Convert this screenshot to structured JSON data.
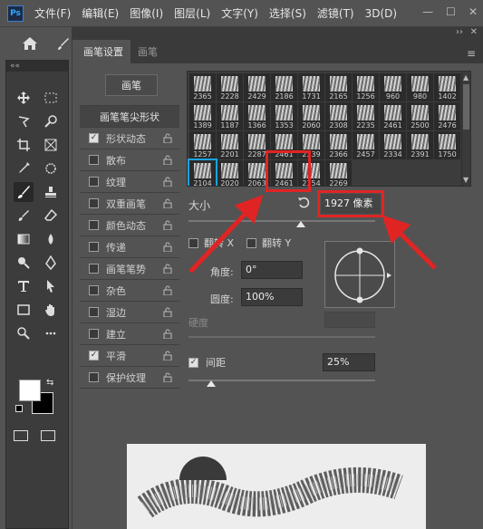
{
  "app": {
    "logo": "Ps"
  },
  "menu": [
    "文件(F)",
    "编辑(E)",
    "图像(I)",
    "图层(L)",
    "文字(Y)",
    "选择(S)",
    "滤镜(T)",
    "3D(D)"
  ],
  "window_controls": [
    "—",
    "☐",
    "✕"
  ],
  "panel": {
    "strip_glyphs": [
      "››",
      "✕"
    ],
    "tabs": [
      {
        "label": "画笔设置",
        "active": true
      },
      {
        "label": "画笔",
        "active": false
      }
    ],
    "menu_glyph": "≡",
    "brush_button": "画笔",
    "options": [
      {
        "label": "画笔笔尖形状",
        "header": true
      },
      {
        "label": "形状动态",
        "checked": true,
        "lock": true
      },
      {
        "label": "散布",
        "checked": false,
        "lock": true
      },
      {
        "label": "纹理",
        "checked": false,
        "lock": true
      },
      {
        "label": "双重画笔",
        "checked": false,
        "lock": true
      },
      {
        "label": "颜色动态",
        "checked": false,
        "lock": true
      },
      {
        "label": "传递",
        "checked": false,
        "lock": true
      },
      {
        "label": "画笔笔势",
        "checked": false,
        "lock": true
      },
      {
        "label": "杂色",
        "checked": false,
        "lock": true
      },
      {
        "label": "湿边",
        "checked": false,
        "lock": true
      },
      {
        "label": "建立",
        "checked": false,
        "lock": true
      },
      {
        "label": "平滑",
        "checked": true,
        "lock": true
      },
      {
        "label": "保护纹理",
        "checked": false,
        "lock": true
      }
    ],
    "brush_tips": [
      "2365",
      "2228",
      "2429",
      "2186",
      "1731",
      "2165",
      "1256",
      "960",
      "980",
      "1402",
      "1389",
      "1187",
      "1366",
      "1353",
      "2060",
      "2308",
      "2235",
      "2461",
      "2500",
      "2476",
      "1257",
      "2201",
      "2287",
      "2461",
      "2339",
      "2366",
      "2457",
      "2334",
      "2391",
      "1750",
      "2104",
      "2020",
      "2063",
      "2461",
      "2354",
      "2269"
    ],
    "selected_tip": "2104",
    "size_label": "大小",
    "size_value": "1927 像素",
    "size_slider": 0.6,
    "flip_x": "翻转 X",
    "flip_y": "翻转 Y",
    "angle_label": "角度:",
    "angle_value": "0°",
    "roundness_label": "圆度:",
    "roundness_value": "100%",
    "hardness_label": "硬度",
    "spacing_label": "间距",
    "spacing_value": "25%",
    "spacing_checked": true,
    "spacing_slider": 0.12
  },
  "colors": {
    "accent": "#1aa3e3",
    "annotation": "#e02424",
    "foreground": "#ffffff",
    "background": "#000000"
  }
}
